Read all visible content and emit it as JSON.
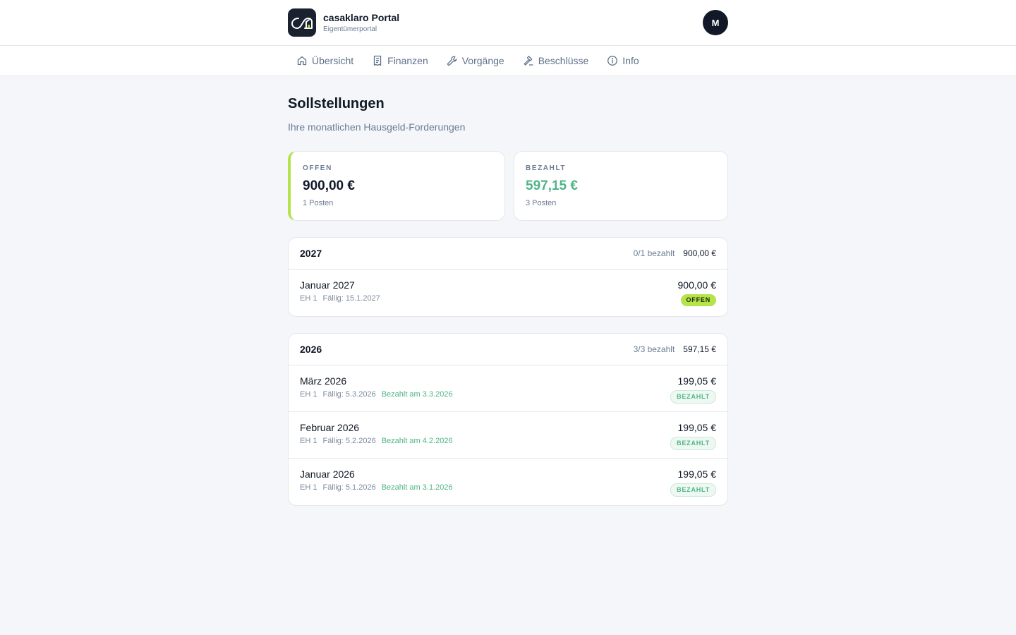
{
  "header": {
    "title": "casaklaro Portal",
    "subtitle": "Eigentümerportal",
    "avatar_initial": "M"
  },
  "nav": {
    "items": [
      {
        "label": "Übersicht",
        "icon": "home-icon"
      },
      {
        "label": "Finanzen",
        "icon": "receipt-icon"
      },
      {
        "label": "Vorgänge",
        "icon": "wrench-icon"
      },
      {
        "label": "Beschlüsse",
        "icon": "gavel-icon"
      },
      {
        "label": "Info",
        "icon": "info-icon"
      }
    ]
  },
  "page": {
    "title": "Sollstellungen",
    "subtitle": "Ihre monatlichen Hausgeld-Forderungen"
  },
  "summary": {
    "open": {
      "label": "OFFEN",
      "value": "900,00 €",
      "count": "1 Posten"
    },
    "paid": {
      "label": "BEZAHLT",
      "value": "597,15 €",
      "count": "3 Posten"
    }
  },
  "years": [
    {
      "year": "2027",
      "paid_status": "0/1 bezahlt",
      "total": "900,00 €",
      "rows": [
        {
          "title": "Januar 2027",
          "unit": "EH 1",
          "due": "Fällig: 15.1.2027",
          "paid_on": "",
          "amount": "900,00 €",
          "badge": "OFFEN"
        }
      ]
    },
    {
      "year": "2026",
      "paid_status": "3/3 bezahlt",
      "total": "597,15 €",
      "rows": [
        {
          "title": "März 2026",
          "unit": "EH 1",
          "due": "Fällig: 5.3.2026",
          "paid_on": "Bezahlt am 3.3.2026",
          "amount": "199,05 €",
          "badge": "BEZAHLT"
        },
        {
          "title": "Februar 2026",
          "unit": "EH 1",
          "due": "Fällig: 5.2.2026",
          "paid_on": "Bezahlt am 4.2.2026",
          "amount": "199,05 €",
          "badge": "BEZAHLT"
        },
        {
          "title": "Januar 2026",
          "unit": "EH 1",
          "due": "Fällig: 5.1.2026",
          "paid_on": "Bezahlt am 3.1.2026",
          "amount": "199,05 €",
          "badge": "BEZAHLT"
        }
      ]
    }
  ],
  "colors": {
    "accent": "#b4e34a",
    "paid_green": "#4fb587",
    "dark": "#111827"
  }
}
